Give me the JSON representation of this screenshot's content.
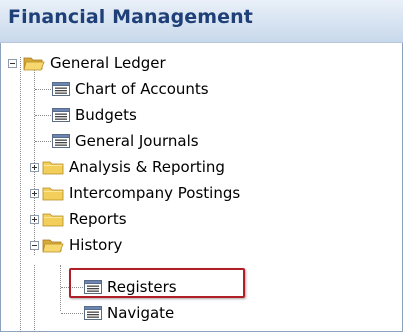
{
  "header": {
    "title": "Financial Management"
  },
  "tree": {
    "root": {
      "label": "General Ledger",
      "expanded": true,
      "icon": "folder-open-icon"
    },
    "items": [
      {
        "label": "Chart of Accounts",
        "icon": "list-window-icon"
      },
      {
        "label": "Budgets",
        "icon": "list-window-icon"
      },
      {
        "label": "General Journals",
        "icon": "list-window-icon"
      },
      {
        "label": "Analysis & Reporting",
        "icon": "folder-icon",
        "expandable": true
      },
      {
        "label": "Intercompany Postings",
        "icon": "folder-icon",
        "expandable": true
      },
      {
        "label": "Reports",
        "icon": "folder-icon",
        "expandable": true
      },
      {
        "label": "History",
        "icon": "folder-open-icon",
        "expanded": true
      },
      {
        "label": "Registers",
        "icon": "list-window-icon",
        "highlighted": true
      },
      {
        "label": "Navigate",
        "icon": "list-window-icon"
      }
    ]
  },
  "colors": {
    "header_text": "#1f3f78",
    "highlight_border": "#b01e28",
    "folder": "#f2cf5b"
  }
}
